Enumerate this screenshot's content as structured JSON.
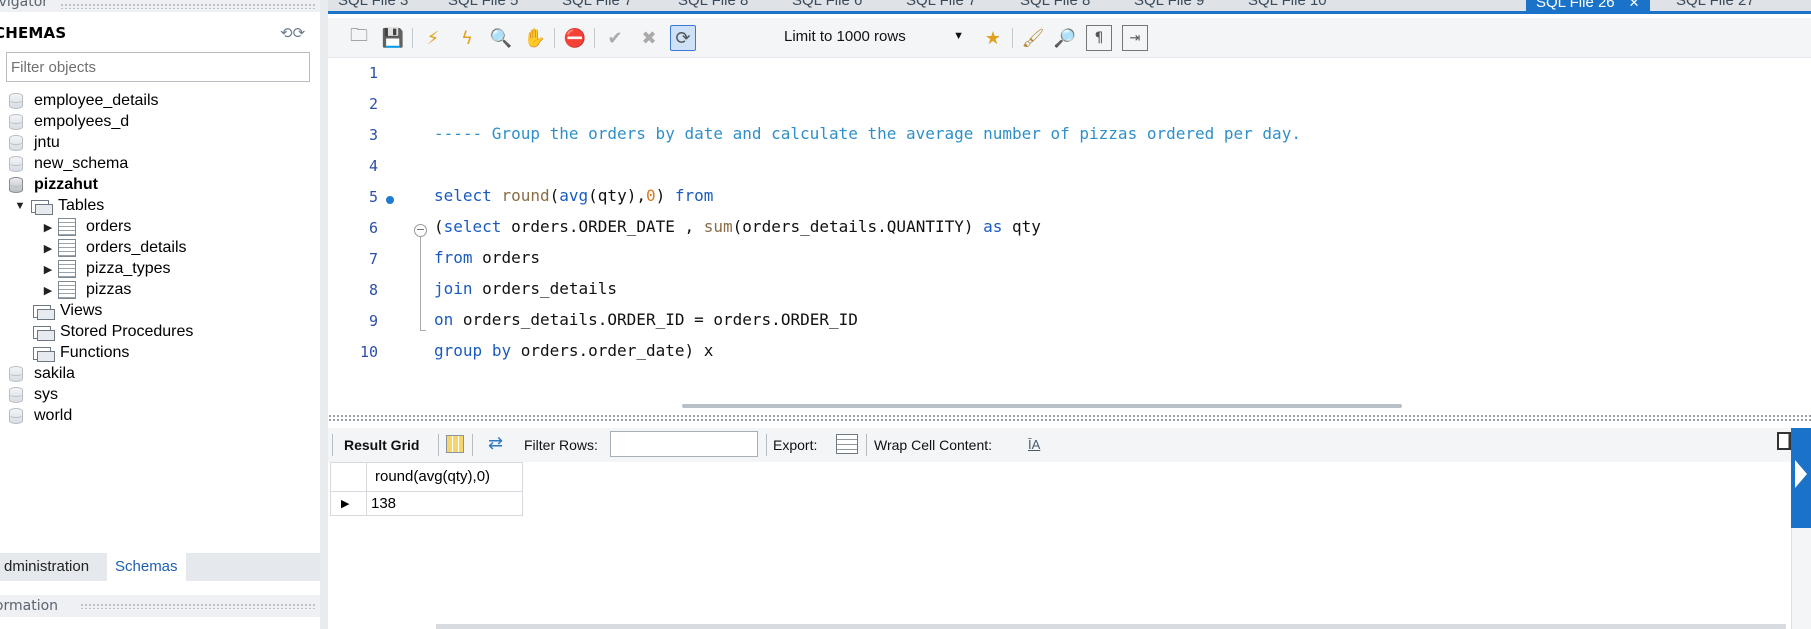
{
  "navigator": {
    "header": "avigator",
    "schemas_title": "CHEMAS",
    "filter_placeholder": "Filter objects",
    "schemas": [
      {
        "name": "employee_details"
      },
      {
        "name": "empolyees_d"
      },
      {
        "name": "jntu"
      },
      {
        "name": "new_schema"
      },
      {
        "name": "pizzahut"
      },
      {
        "name": "sakila"
      },
      {
        "name": "sys"
      },
      {
        "name": "world"
      }
    ],
    "pizzahut_children": {
      "tables_label": "Tables",
      "tables": [
        "orders",
        "orders_details",
        "pizza_types",
        "pizzas"
      ],
      "views_label": "Views",
      "procedures_label": "Stored Procedures",
      "functions_label": "Functions"
    },
    "bottom_tabs": [
      "dministration",
      "Schemas"
    ],
    "info_label": "formation"
  },
  "file_tabs": [
    {
      "label": "SQL File 3"
    },
    {
      "label": "SQL File 5"
    },
    {
      "label": "SQL File 7"
    },
    {
      "label": "SQL File 8"
    },
    {
      "label": "SQL File 6"
    },
    {
      "label": "SQL File 7"
    },
    {
      "label": "SQL File 8"
    },
    {
      "label": "SQL File 9"
    },
    {
      "label": "SQL File 10"
    },
    {
      "label": "SQL File 26",
      "active": true
    },
    {
      "label": "SQL File 27"
    }
  ],
  "toolbar": {
    "limit_label": "Limit to 1000 rows",
    "icons": [
      "open-folder-icon",
      "save-icon",
      "execute-icon",
      "execute-current-icon",
      "explain-icon",
      "stop-icon",
      "toggle-error-icon",
      "commit-icon",
      "rollback-icon",
      "autocommit-icon",
      "bookmark-icon",
      "beautify-icon",
      "find-icon",
      "invisible-chars-icon",
      "wrap-lines-icon"
    ]
  },
  "editor": {
    "lines": [
      {
        "n": "1",
        "code": ""
      },
      {
        "n": "2",
        "code": ""
      },
      {
        "n": "3",
        "code": "----- Group the orders by date and calculate the average number of pizzas ordered per day."
      },
      {
        "n": "4",
        "code": ""
      },
      {
        "n": "5",
        "code": "select round(avg(qty),0) from"
      },
      {
        "n": "6",
        "code": "(select orders.ORDER_DATE , sum(orders_details.QUANTITY) as qty"
      },
      {
        "n": "7",
        "code": "from orders"
      },
      {
        "n": "8",
        "code": "join orders_details"
      },
      {
        "n": "9",
        "code": "on orders_details.ORDER_ID = orders.ORDER_ID"
      },
      {
        "n": "10",
        "code": "group by orders.order_date) x"
      }
    ]
  },
  "result": {
    "result_grid_label": "Result Grid",
    "filter_rows_label": "Filter Rows:",
    "export_label": "Export:",
    "wrap_label": "Wrap Cell Content:",
    "columns": [
      "round(avg(qty),0)"
    ],
    "rows": [
      [
        "138"
      ]
    ]
  },
  "colors": {
    "accent": "#1a73c8",
    "keyword": "#1a5bbf",
    "comment": "#2f8fc9",
    "number": "#d97a1f"
  }
}
